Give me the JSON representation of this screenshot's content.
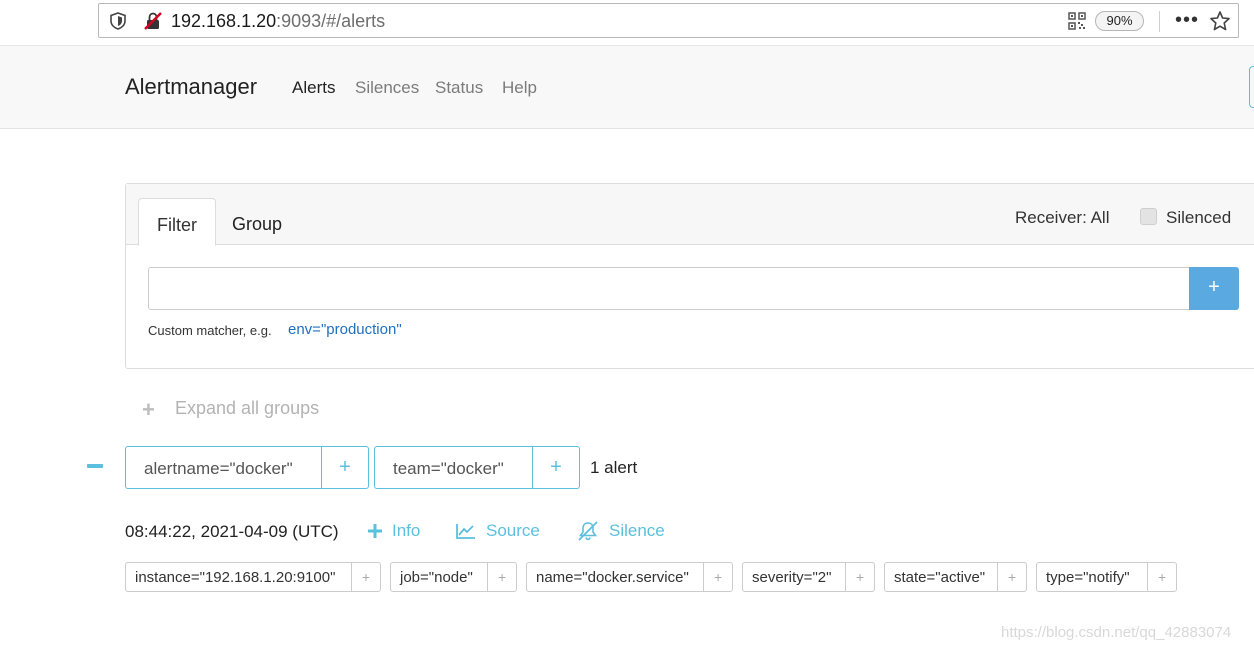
{
  "browser": {
    "url_host": "192.168.1.20",
    "url_rest": ":9093/#/alerts",
    "zoom": "90%",
    "menu": "•••"
  },
  "navbar": {
    "brand": "Alertmanager",
    "links": [
      "Alerts",
      "Silences",
      "Status",
      "Help"
    ],
    "active": "Alerts"
  },
  "filter_panel": {
    "tabs": [
      "Filter",
      "Group"
    ],
    "active_tab": "Filter",
    "receiver": "Receiver: All",
    "silenced_label": "Silenced",
    "input_value": "",
    "add_button": "+",
    "hint": "Custom matcher, e.g.",
    "hint_example": "env=\"production\""
  },
  "expand": {
    "plus": "+",
    "label": "Expand all groups"
  },
  "group": {
    "collapse": "−",
    "labels": [
      {
        "text": "alertname=\"docker\"",
        "plus": "+"
      },
      {
        "text": "team=\"docker\"",
        "plus": "+"
      }
    ],
    "count": "1 alert"
  },
  "alert": {
    "time": "08:44:22, 2021-04-09 (UTC)",
    "actions": [
      "Info",
      "Source",
      "Silence"
    ],
    "labels": [
      {
        "text": "instance=\"192.168.1.20:9100\"",
        "plus": "+"
      },
      {
        "text": "job=\"node\"",
        "plus": "+"
      },
      {
        "text": "name=\"docker.service\"",
        "plus": "+"
      },
      {
        "text": "severity=\"2\"",
        "plus": "+"
      },
      {
        "text": "state=\"active\"",
        "plus": "+"
      },
      {
        "text": "type=\"notify\"",
        "plus": "+"
      }
    ]
  },
  "watermark": "https://blog.csdn.net/qq_42883074",
  "colors": {
    "accent": "#5bc0de",
    "primary_button": "#5ba9e1",
    "link": "#1f6fc0"
  }
}
